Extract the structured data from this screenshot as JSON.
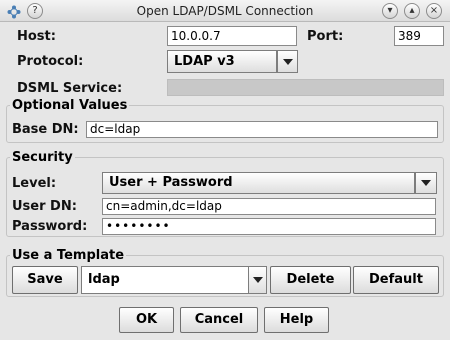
{
  "window": {
    "title": "Open LDAP/DSML Connection",
    "controls": {
      "help": "?",
      "minimize": "▾",
      "maximize": "▴",
      "close": "×"
    }
  },
  "connection": {
    "host_label": "Host:",
    "host_value": "10.0.0.7",
    "port_label": "Port:",
    "port_value": "389",
    "protocol_label": "Protocol:",
    "protocol_value": "LDAP v3",
    "dsml_label": "DSML Service:",
    "dsml_value": ""
  },
  "optional": {
    "title": "Optional Values",
    "base_dn_label": "Base DN:",
    "base_dn_value": "dc=ldap"
  },
  "security": {
    "title": "Security",
    "level_label": "Level:",
    "level_value": "User + Password",
    "user_dn_label": "User DN:",
    "user_dn_value": "cn=admin,dc=ldap",
    "password_label": "Password:",
    "password_value": "••••••••"
  },
  "template": {
    "title": "Use a Template",
    "save_label": "Save",
    "template_value": "ldap",
    "delete_label": "Delete",
    "default_label": "Default"
  },
  "buttons": {
    "ok": "OK",
    "cancel": "Cancel",
    "help": "Help"
  },
  "icons": {
    "app_icon": "network-icon",
    "help_icon": "help-icon",
    "minimize_icon": "chevron-down-icon",
    "maximize_icon": "chevron-up-icon",
    "close_icon": "close-icon"
  }
}
